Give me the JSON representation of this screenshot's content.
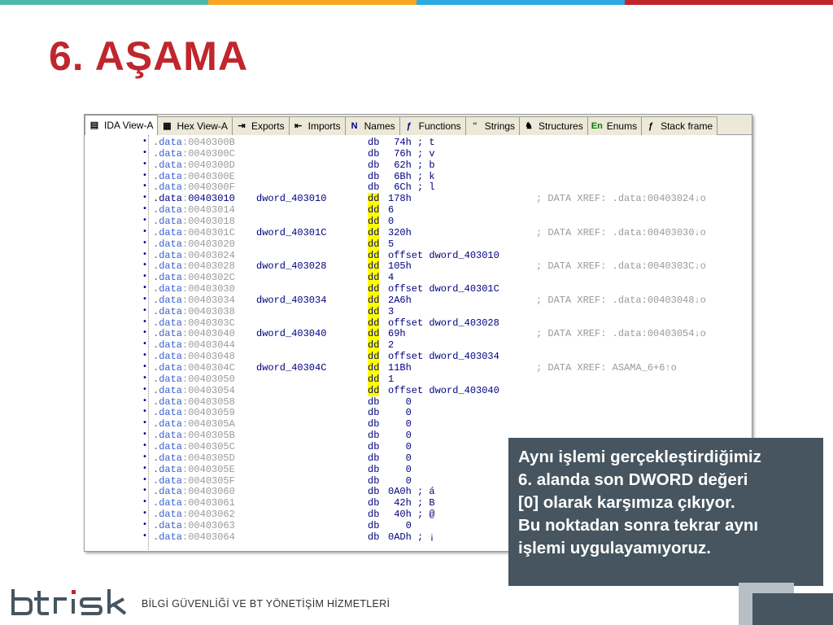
{
  "slide": {
    "title": "6. AŞAMA",
    "top_bar_colors": [
      "#4eb8a8",
      "#f5a623",
      "#29aae1",
      "#c0262c"
    ]
  },
  "ida": {
    "tabs": [
      {
        "label": "IDA View-A",
        "icon": "listing-icon",
        "active": true
      },
      {
        "label": "Hex View-A",
        "icon": "hex-icon",
        "active": false
      },
      {
        "label": "Exports",
        "icon": "exports-icon",
        "active": false
      },
      {
        "label": "Imports",
        "icon": "imports-icon",
        "active": false
      },
      {
        "label": "Names",
        "icon": "names-icon",
        "active": false
      },
      {
        "label": "Functions",
        "icon": "functions-icon",
        "active": false
      },
      {
        "label": "Strings",
        "icon": "strings-icon",
        "active": false
      },
      {
        "label": "Structures",
        "icon": "structures-icon",
        "active": false
      },
      {
        "label": "Enums",
        "icon": "enums-icon",
        "active": false
      },
      {
        "label": "Stack frame",
        "icon": "stack-frame-icon",
        "active": false
      }
    ],
    "rows": [
      {
        "seg": ".data",
        "addr": "0040300B",
        "name": "",
        "mnem": "db",
        "ops": " 74h ; t",
        "cmt": "",
        "hl": false
      },
      {
        "seg": ".data",
        "addr": "0040300C",
        "name": "",
        "mnem": "db",
        "ops": " 76h ; v",
        "cmt": "",
        "hl": false
      },
      {
        "seg": ".data",
        "addr": "0040300D",
        "name": "",
        "mnem": "db",
        "ops": " 62h ; b",
        "cmt": "",
        "hl": false
      },
      {
        "seg": ".data",
        "addr": "0040300E",
        "name": "",
        "mnem": "db",
        "ops": " 6Bh ; k",
        "cmt": "",
        "hl": false
      },
      {
        "seg": ".data",
        "addr": "0040300F",
        "name": "",
        "mnem": "db",
        "ops": " 6Ch ; l",
        "cmt": "",
        "hl": false
      },
      {
        "seg": ".data",
        "addr": "00403010",
        "name": "dword_403010",
        "mnem": "dd",
        "ops": "178h",
        "cmt": "; DATA XREF: .data:00403024↓o",
        "hl": true,
        "addrhl": true
      },
      {
        "seg": ".data",
        "addr": "00403014",
        "name": "",
        "mnem": "dd",
        "ops": "6",
        "cmt": "",
        "hl": true
      },
      {
        "seg": ".data",
        "addr": "00403018",
        "name": "",
        "mnem": "dd",
        "ops": "0",
        "cmt": "",
        "hl": true
      },
      {
        "seg": ".data",
        "addr": "0040301C",
        "name": "dword_40301C",
        "mnem": "dd",
        "ops": "320h",
        "cmt": "; DATA XREF: .data:00403030↓o",
        "hl": true
      },
      {
        "seg": ".data",
        "addr": "00403020",
        "name": "",
        "mnem": "dd",
        "ops": "5",
        "cmt": "",
        "hl": true
      },
      {
        "seg": ".data",
        "addr": "00403024",
        "name": "",
        "mnem": "dd",
        "ops": "offset dword_403010",
        "cmt": "",
        "hl": true
      },
      {
        "seg": ".data",
        "addr": "00403028",
        "name": "dword_403028",
        "mnem": "dd",
        "ops": "105h",
        "cmt": "; DATA XREF: .data:0040303C↓o",
        "hl": true
      },
      {
        "seg": ".data",
        "addr": "0040302C",
        "name": "",
        "mnem": "dd",
        "ops": "4",
        "cmt": "",
        "hl": true
      },
      {
        "seg": ".data",
        "addr": "00403030",
        "name": "",
        "mnem": "dd",
        "ops": "offset dword_40301C",
        "cmt": "",
        "hl": true
      },
      {
        "seg": ".data",
        "addr": "00403034",
        "name": "dword_403034",
        "mnem": "dd",
        "ops": "2A6h",
        "cmt": "; DATA XREF: .data:00403048↓o",
        "hl": true
      },
      {
        "seg": ".data",
        "addr": "00403038",
        "name": "",
        "mnem": "dd",
        "ops": "3",
        "cmt": "",
        "hl": true
      },
      {
        "seg": ".data",
        "addr": "0040303C",
        "name": "",
        "mnem": "dd",
        "ops": "offset dword_403028",
        "cmt": "",
        "hl": true
      },
      {
        "seg": ".data",
        "addr": "00403040",
        "name": "dword_403040",
        "mnem": "dd",
        "ops": "69h",
        "cmt": "; DATA XREF: .data:00403054↓o",
        "hl": true
      },
      {
        "seg": ".data",
        "addr": "00403044",
        "name": "",
        "mnem": "dd",
        "ops": "2",
        "cmt": "",
        "hl": true
      },
      {
        "seg": ".data",
        "addr": "00403048",
        "name": "",
        "mnem": "dd",
        "ops": "offset dword_403034",
        "cmt": "",
        "hl": true
      },
      {
        "seg": ".data",
        "addr": "0040304C",
        "name": "dword_40304C",
        "mnem": "dd",
        "ops": "11Bh",
        "cmt": "; DATA XREF: ASAMA_6+6↑o",
        "hl": true
      },
      {
        "seg": ".data",
        "addr": "00403050",
        "name": "",
        "mnem": "dd",
        "ops": "1",
        "cmt": "",
        "hl": true
      },
      {
        "seg": ".data",
        "addr": "00403054",
        "name": "",
        "mnem": "dd",
        "ops": "offset dword_403040",
        "cmt": "",
        "hl": true
      },
      {
        "seg": ".data",
        "addr": "00403058",
        "name": "",
        "mnem": "db",
        "ops": "   0",
        "cmt": "",
        "hl": false
      },
      {
        "seg": ".data",
        "addr": "00403059",
        "name": "",
        "mnem": "db",
        "ops": "   0",
        "cmt": "",
        "hl": false
      },
      {
        "seg": ".data",
        "addr": "0040305A",
        "name": "",
        "mnem": "db",
        "ops": "   0",
        "cmt": "",
        "hl": false
      },
      {
        "seg": ".data",
        "addr": "0040305B",
        "name": "",
        "mnem": "db",
        "ops": "   0",
        "cmt": "",
        "hl": false
      },
      {
        "seg": ".data",
        "addr": "0040305C",
        "name": "",
        "mnem": "db",
        "ops": "   0",
        "cmt": "",
        "hl": false
      },
      {
        "seg": ".data",
        "addr": "0040305D",
        "name": "",
        "mnem": "db",
        "ops": "   0",
        "cmt": "",
        "hl": false
      },
      {
        "seg": ".data",
        "addr": "0040305E",
        "name": "",
        "mnem": "db",
        "ops": "   0",
        "cmt": "",
        "hl": false
      },
      {
        "seg": ".data",
        "addr": "0040305F",
        "name": "",
        "mnem": "db",
        "ops": "   0",
        "cmt": "",
        "hl": false
      },
      {
        "seg": ".data",
        "addr": "00403060",
        "name": "",
        "mnem": "db",
        "ops": "0A0h ; á",
        "cmt": "",
        "hl": false
      },
      {
        "seg": ".data",
        "addr": "00403061",
        "name": "",
        "mnem": "db",
        "ops": " 42h ; B",
        "cmt": "",
        "hl": false
      },
      {
        "seg": ".data",
        "addr": "00403062",
        "name": "",
        "mnem": "db",
        "ops": " 40h ; @",
        "cmt": "",
        "hl": false
      },
      {
        "seg": ".data",
        "addr": "00403063",
        "name": "",
        "mnem": "db",
        "ops": "   0",
        "cmt": "",
        "hl": false
      },
      {
        "seg": ".data",
        "addr": "00403064",
        "name": "",
        "mnem": "db",
        "ops": "0ADh ; ¡",
        "cmt": "",
        "hl": false
      }
    ]
  },
  "callout": {
    "lines": [
      "Aynı işlemi gerçekleştirdiğimiz",
      "6. alanda son DWORD değeri",
      "[0] olarak karşımıza çıkıyor.",
      "Bu noktadan sonra tekrar aynı",
      "işlemi uygulayamıyoruz."
    ]
  },
  "footer": {
    "logo_text": "btrisk",
    "tagline": "BİLGİ GÜVENLİĞİ VE BT YÖNETİŞİM HİZMETLERİ"
  }
}
